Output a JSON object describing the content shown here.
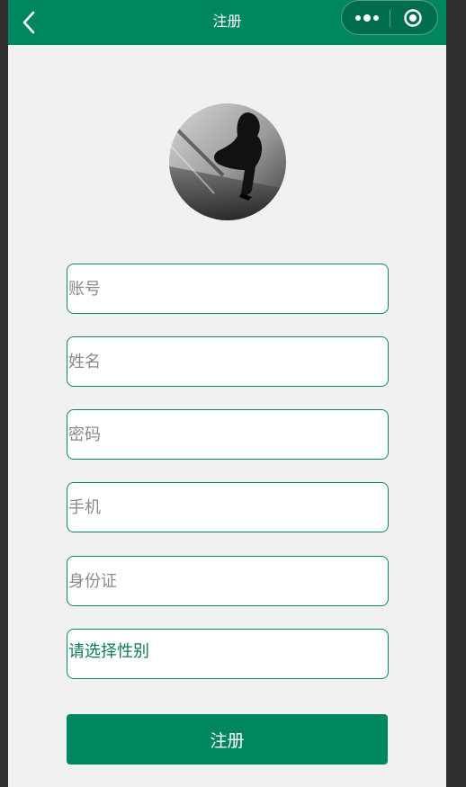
{
  "navbar": {
    "title": "注册",
    "back_icon": "chevron-left-icon",
    "more_icon": "more-dots-icon",
    "close_icon": "target-circle-icon",
    "background": "#008760"
  },
  "avatar": {
    "alt": "avatar"
  },
  "form": {
    "fields": [
      {
        "placeholder": "账号",
        "value": ""
      },
      {
        "placeholder": "姓名",
        "value": ""
      },
      {
        "placeholder": "密码",
        "value": ""
      },
      {
        "placeholder": "手机",
        "value": ""
      },
      {
        "placeholder": "身份证",
        "value": ""
      }
    ],
    "gender_picker": {
      "label": "请选择性别"
    },
    "border_color": "#0a8a63"
  },
  "submit": {
    "label": "注册"
  }
}
